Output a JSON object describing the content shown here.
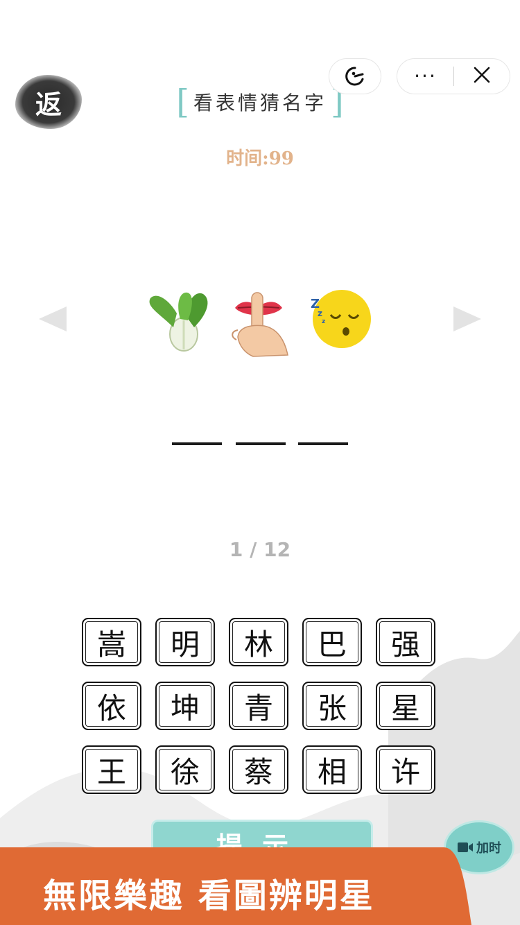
{
  "header": {
    "back_label": "返",
    "title": "看表情猜名字",
    "timer": "时间:99"
  },
  "capsule": {
    "game_icon": "game-face-icon",
    "more_label": "···",
    "close_icon": "close-icon"
  },
  "puzzle": {
    "emojis": [
      "bok-choy-icon",
      "shush-lips-icon",
      "sleeping-face-icon"
    ],
    "answer_slots": 3
  },
  "progress": "1 / 12",
  "choices": [
    [
      "嵩",
      "明",
      "林",
      "巴",
      "强"
    ],
    [
      "依",
      "坤",
      "青",
      "张",
      "星"
    ],
    [
      "王",
      "徐",
      "蔡",
      "相",
      "许"
    ]
  ],
  "hint_label": "提示",
  "add_time_label": "加时",
  "banner_text": "無限樂趣 看圖辨明星",
  "colors": {
    "accent_teal": "#8fd6cf",
    "timer": "#e2b38b",
    "banner": "#e06a34"
  }
}
